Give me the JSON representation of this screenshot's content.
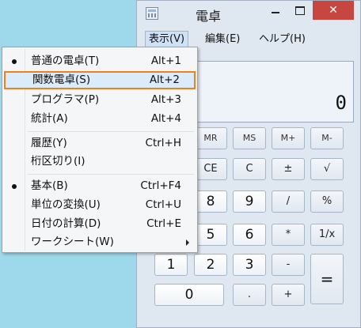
{
  "window": {
    "title": "電卓",
    "close_glyph": "✕"
  },
  "menubar": {
    "items": [
      "表示(V)",
      "編集(E)",
      "ヘルプ(H)"
    ]
  },
  "display": {
    "value": "0"
  },
  "keys": {
    "memory": [
      "MR",
      "MS",
      "M+",
      "M-"
    ],
    "row2": [
      "CE",
      "C",
      "±",
      "√"
    ],
    "row3": [
      "8",
      "9",
      "/",
      "%"
    ],
    "row4": [
      "5",
      "6",
      "*",
      "1/x"
    ],
    "row5": [
      "1",
      "2",
      "3",
      "-"
    ],
    "row6": [
      "0",
      ".",
      "+"
    ],
    "equals": "="
  },
  "view_menu": {
    "items": [
      {
        "label": "普通の電卓(T)",
        "accel": "Alt+1",
        "checked": true
      },
      {
        "label": "関数電卓(S)",
        "accel": "Alt+2",
        "highlighted": true
      },
      {
        "label": "プログラマ(P)",
        "accel": "Alt+3"
      },
      {
        "label": "統計(A)",
        "accel": "Alt+4"
      },
      {
        "label": "履歴(Y)",
        "accel": "Ctrl+H"
      },
      {
        "label": "桁区切り(I)",
        "accel": ""
      },
      {
        "label": "基本(B)",
        "accel": "Ctrl+F4",
        "checked": true
      },
      {
        "label": "単位の変換(U)",
        "accel": "Ctrl+U"
      },
      {
        "label": "日付の計算(D)",
        "accel": "Ctrl+E"
      },
      {
        "label": "ワークシート(W)",
        "accel": "",
        "submenu": true
      }
    ]
  }
}
